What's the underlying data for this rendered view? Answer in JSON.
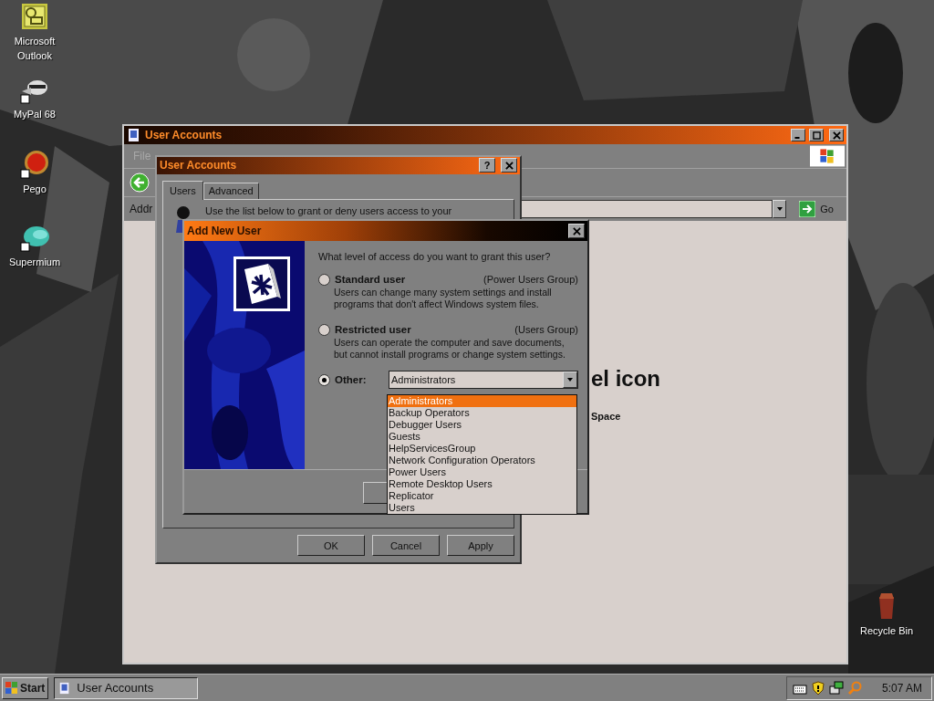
{
  "desktop": {
    "icons": [
      {
        "label": "Microsoft Outlook",
        "kind": "outlook"
      },
      {
        "label": "MyPal 68",
        "kind": "mypal"
      },
      {
        "label": "Pego",
        "kind": "pego"
      },
      {
        "label": "Supermium",
        "kind": "supermium"
      },
      {
        "label": "Recycle Bin",
        "kind": "bin"
      }
    ]
  },
  "main_window": {
    "title": "User Accounts",
    "menu": [
      "File"
    ],
    "address_label": "Addr",
    "go": "Go",
    "heading": "el icon",
    "subheading": "Space"
  },
  "properties_dialog": {
    "title": "User Accounts",
    "help": "?",
    "tabs": [
      {
        "label": "Users",
        "selected": true
      },
      {
        "label": "Advanced",
        "selected": false
      }
    ],
    "intro": "Use the list below to grant or deny users access to your",
    "buttons": [
      "OK",
      "Cancel",
      "Apply"
    ]
  },
  "add_user_dialog": {
    "title": "Add New User",
    "question": "What level of access do you want to grant this user?",
    "options": [
      {
        "label": "Standard user",
        "group": "(Power Users Group)",
        "description": "Users can change many system settings and install programs that don't affect Windows system files.",
        "selected": false
      },
      {
        "label": "Restricted user",
        "group": "(Users Group)",
        "description": "Users can operate the computer and save documents, but cannot install programs or change system settings.",
        "selected": false
      },
      {
        "label": "Other:",
        "selected": true
      }
    ],
    "combo_value": "Administrators",
    "dropdown": [
      {
        "label": "Administrators",
        "selected": true
      },
      {
        "label": "Backup Operators",
        "selected": false
      },
      {
        "label": "Debugger Users",
        "selected": false
      },
      {
        "label": "Guests",
        "selected": false
      },
      {
        "label": "HelpServicesGroup",
        "selected": false
      },
      {
        "label": "Network Configuration Operators",
        "selected": false
      },
      {
        "label": "Power Users",
        "selected": false
      },
      {
        "label": "Remote Desktop Users",
        "selected": false
      },
      {
        "label": "Replicator",
        "selected": false
      },
      {
        "label": "Users",
        "selected": false
      }
    ]
  },
  "taskbar": {
    "start": "Start",
    "tasks": [
      {
        "label": "User Accounts"
      }
    ],
    "clock": "5:07 AM"
  }
}
